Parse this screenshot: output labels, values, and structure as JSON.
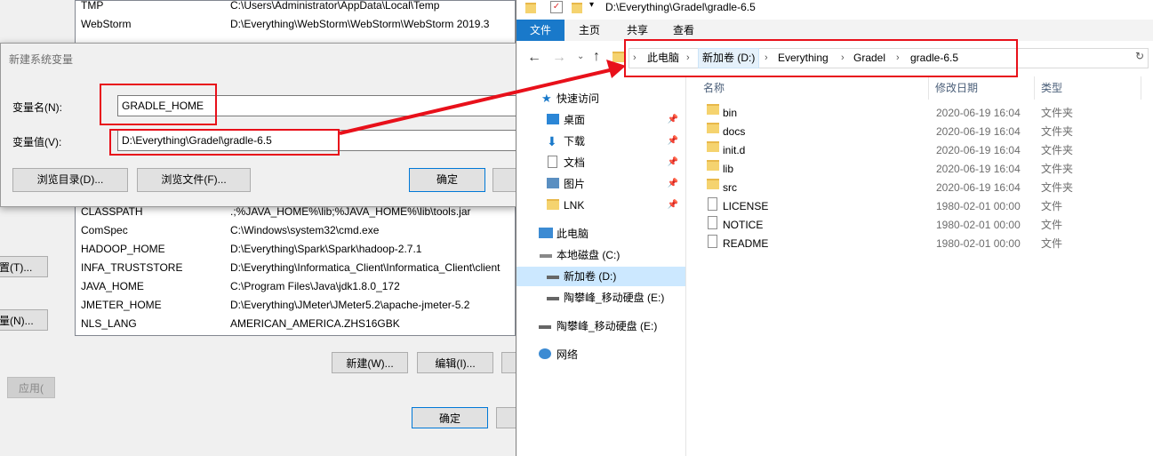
{
  "env_vars": [
    {
      "name": "TMP",
      "value": "C:\\Users\\Administrator\\AppData\\Local\\Temp"
    },
    {
      "name": "WebStorm",
      "value": "D:\\Everything\\WebStorm\\WebStorm\\WebStorm 2019.3"
    },
    {
      "name": "CLASSPATH",
      "value": ".;%JAVA_HOME%\\lib;%JAVA_HOME%\\lib\\tools.jar"
    },
    {
      "name": "ComSpec",
      "value": "C:\\Windows\\system32\\cmd.exe"
    },
    {
      "name": "HADOOP_HOME",
      "value": "D:\\Everything\\Spark\\Spark\\hadoop-2.7.1"
    },
    {
      "name": "INFA_TRUSTSTORE",
      "value": "D:\\Everything\\Informatica_Client\\Informatica_Client\\client"
    },
    {
      "name": "JAVA_HOME",
      "value": "C:\\Program Files\\Java\\jdk1.8.0_172"
    },
    {
      "name": "JMETER_HOME",
      "value": "D:\\Everything\\JMeter\\JMeter5.2\\apache-jmeter-5.2"
    },
    {
      "name": "NLS_LANG",
      "value": "AMERICAN_AMERICA.ZHS16GBK"
    }
  ],
  "sysprops": {
    "left_btn_1": "置(T)...",
    "left_btn_2": "量(N)...",
    "apply_btn": "应用(",
    "new_btn": "新建(W)...",
    "edit_btn": "编辑(I)...",
    "ok_btn": "确定"
  },
  "dialog": {
    "title": "新建系统变量",
    "name_label": "变量名(N):",
    "value_label": "变量值(V):",
    "name_value": "GRADLE_HOME",
    "value_value": "D:\\Everything\\Gradel\\gradle-6.5",
    "browse_dir": "浏览目录(D)...",
    "browse_file": "浏览文件(F)...",
    "ok": "确定"
  },
  "explorer": {
    "title_path": "D:\\Everything\\Gradel\\gradle-6.5",
    "tabs": {
      "file": "文件",
      "home": "主页",
      "share": "共享",
      "view": "查看"
    },
    "breadcrumbs": [
      "此电脑",
      "新加卷 (D:)",
      "Everything",
      "Gradel",
      "gradle-6.5"
    ],
    "nav": {
      "quick_access": "快速访问",
      "desktop": "桌面",
      "downloads": "下载",
      "documents": "文档",
      "pictures": "图片",
      "lnk": "LNK",
      "this_pc": "此电脑",
      "local_c": "本地磁盘 (C:)",
      "new_d": "新加卷 (D:)",
      "removable_e": "陶攀峰_移动硬盘 (E:)",
      "removable_e2": "陶攀峰_移动硬盘 (E:)",
      "network": "网络"
    },
    "columns": {
      "name": "名称",
      "modified": "修改日期",
      "type": "类型"
    },
    "files": [
      {
        "name": "bin",
        "date": "2020-06-19 16:04",
        "type": "文件夹"
      },
      {
        "name": "docs",
        "date": "2020-06-19 16:04",
        "type": "文件夹"
      },
      {
        "name": "init.d",
        "date": "2020-06-19 16:04",
        "type": "文件夹"
      },
      {
        "name": "lib",
        "date": "2020-06-19 16:04",
        "type": "文件夹"
      },
      {
        "name": "src",
        "date": "2020-06-19 16:04",
        "type": "文件夹"
      },
      {
        "name": "LICENSE",
        "date": "1980-02-01 00:00",
        "type": "文件"
      },
      {
        "name": "NOTICE",
        "date": "1980-02-01 00:00",
        "type": "文件"
      },
      {
        "name": "README",
        "date": "1980-02-01 00:00",
        "type": "文件"
      }
    ]
  },
  "colors": {
    "accent": "#1979ca",
    "annotation": "#e8101a",
    "selection": "#cce8ff"
  }
}
